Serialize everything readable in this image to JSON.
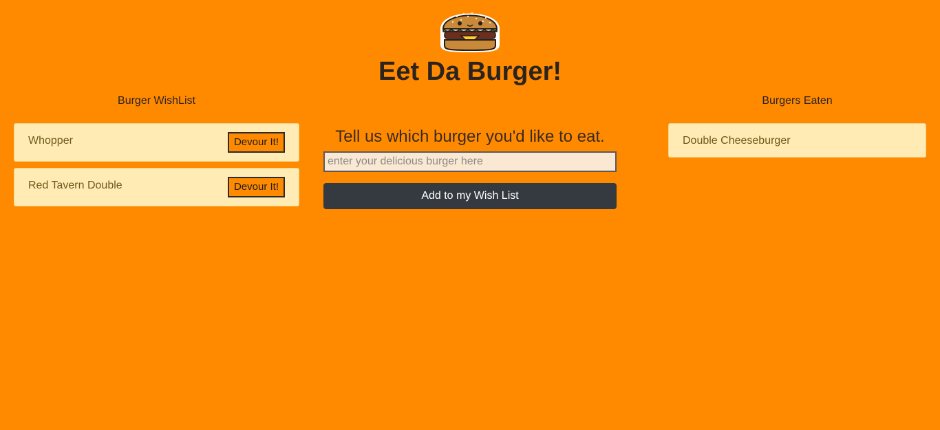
{
  "header": {
    "logo_icon": "burger-icon",
    "title": "Eet Da Burger!"
  },
  "wishlist": {
    "heading": "Burger WishList",
    "items": [
      {
        "name": "Whopper",
        "button_label": "Devour It!"
      },
      {
        "name": "Red Tavern Double",
        "button_label": "Devour It!"
      }
    ]
  },
  "form": {
    "prompt": "Tell us which burger you'd like to eat.",
    "input_value": "",
    "input_placeholder": "enter your delicious burger here",
    "submit_label": "Add to my Wish List"
  },
  "eaten": {
    "heading": "Burgers Eaten",
    "items": [
      {
        "name": "Double Cheeseburger"
      }
    ]
  },
  "colors": {
    "background": "#ff8a00",
    "card": "#ffebb3",
    "button_dark": "#343a40"
  }
}
